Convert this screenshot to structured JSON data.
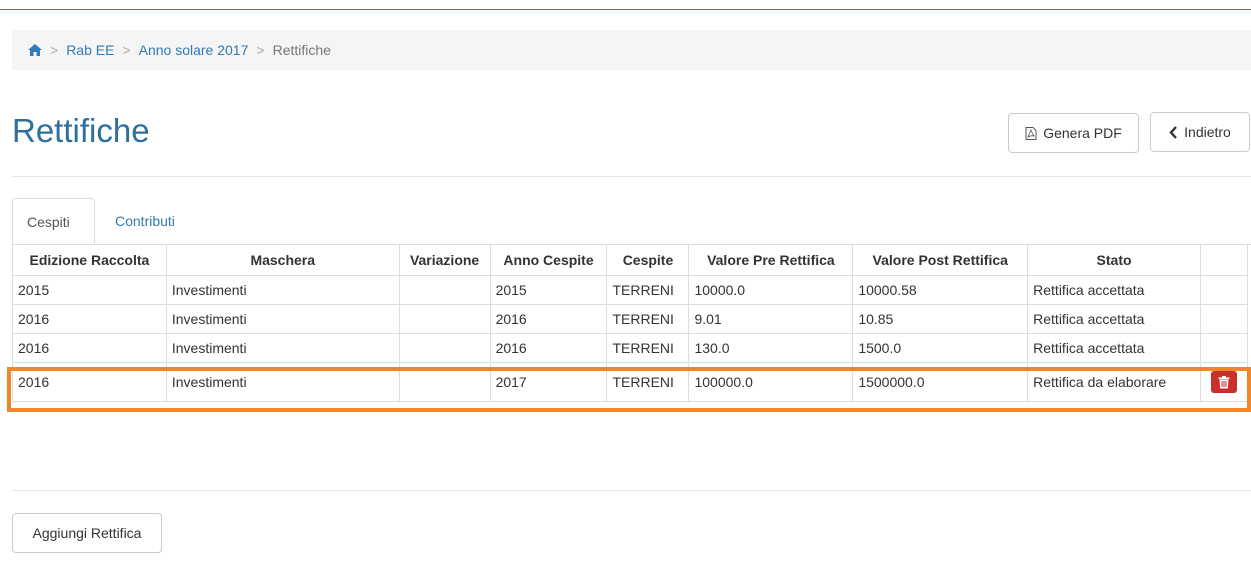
{
  "breadcrumb": {
    "items": [
      "Rab EE",
      "Anno solare 2017"
    ],
    "current": "Rettifiche",
    "separator": ">"
  },
  "page": {
    "title": "Rettifiche"
  },
  "actions": {
    "pdf_label": "Genera PDF",
    "back_label": "Indietro",
    "add_label": "Aggiungi Rettifica"
  },
  "tabs": [
    {
      "label": "Cespiti",
      "active": true
    },
    {
      "label": "Contributi",
      "active": false
    }
  ],
  "table": {
    "headers": [
      "Edizione Raccolta",
      "Maschera",
      "Variazione",
      "Anno Cespite",
      "Cespite",
      "Valore Pre Rettifica",
      "Valore Post Rettifica",
      "Stato",
      ""
    ],
    "rows": [
      [
        "2015",
        "Investimenti",
        "",
        "2015",
        "TERRENI",
        "10000.0",
        "10000.58",
        "Rettifica accettata"
      ],
      [
        "2016",
        "Investimenti",
        "",
        "2016",
        "TERRENI",
        "9.01",
        "10.85",
        "Rettifica accettata"
      ],
      [
        "2016",
        "Investimenti",
        "",
        "2016",
        "TERRENI",
        "130.0",
        "1500.0",
        "Rettifica accettata"
      ],
      [
        "2016",
        "Investimenti",
        "",
        "2017",
        "TERRENI",
        "100000.0",
        "1500000.0",
        "Rettifica da elaborare"
      ]
    ]
  },
  "icons": {
    "home": "home-icon",
    "pdf": "file-pdf-icon",
    "back": "chevron-left-icon",
    "delete": "trash-icon"
  },
  "colors": {
    "accent": "#337ab7",
    "title": "#2e6f9e",
    "danger": "#c9302c",
    "highlight": "#f0862a"
  }
}
